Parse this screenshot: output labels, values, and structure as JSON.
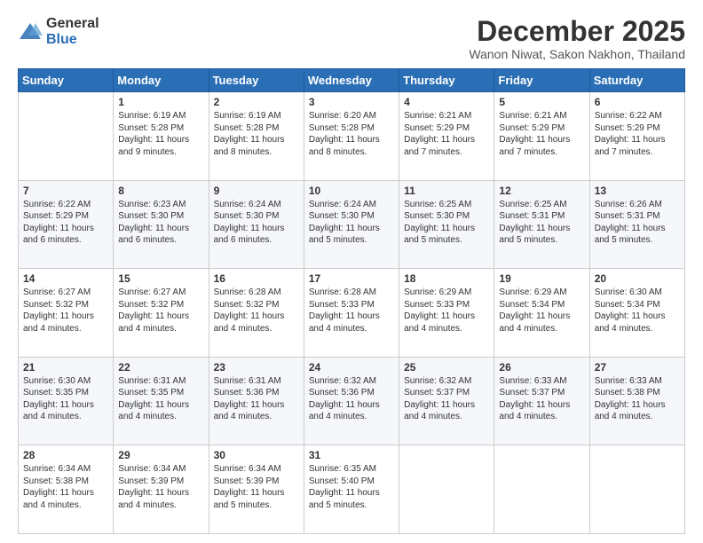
{
  "logo": {
    "general": "General",
    "blue": "Blue"
  },
  "header": {
    "title": "December 2025",
    "subtitle": "Wanon Niwat, Sakon Nakhon, Thailand"
  },
  "weekdays": [
    "Sunday",
    "Monday",
    "Tuesday",
    "Wednesday",
    "Thursday",
    "Friday",
    "Saturday"
  ],
  "weeks": [
    [
      {
        "day": "",
        "sunrise": "",
        "sunset": "",
        "daylight": ""
      },
      {
        "day": "1",
        "sunrise": "Sunrise: 6:19 AM",
        "sunset": "Sunset: 5:28 PM",
        "daylight": "Daylight: 11 hours and 9 minutes."
      },
      {
        "day": "2",
        "sunrise": "Sunrise: 6:19 AM",
        "sunset": "Sunset: 5:28 PM",
        "daylight": "Daylight: 11 hours and 8 minutes."
      },
      {
        "day": "3",
        "sunrise": "Sunrise: 6:20 AM",
        "sunset": "Sunset: 5:28 PM",
        "daylight": "Daylight: 11 hours and 8 minutes."
      },
      {
        "day": "4",
        "sunrise": "Sunrise: 6:21 AM",
        "sunset": "Sunset: 5:29 PM",
        "daylight": "Daylight: 11 hours and 7 minutes."
      },
      {
        "day": "5",
        "sunrise": "Sunrise: 6:21 AM",
        "sunset": "Sunset: 5:29 PM",
        "daylight": "Daylight: 11 hours and 7 minutes."
      },
      {
        "day": "6",
        "sunrise": "Sunrise: 6:22 AM",
        "sunset": "Sunset: 5:29 PM",
        "daylight": "Daylight: 11 hours and 7 minutes."
      }
    ],
    [
      {
        "day": "7",
        "sunrise": "Sunrise: 6:22 AM",
        "sunset": "Sunset: 5:29 PM",
        "daylight": "Daylight: 11 hours and 6 minutes."
      },
      {
        "day": "8",
        "sunrise": "Sunrise: 6:23 AM",
        "sunset": "Sunset: 5:30 PM",
        "daylight": "Daylight: 11 hours and 6 minutes."
      },
      {
        "day": "9",
        "sunrise": "Sunrise: 6:24 AM",
        "sunset": "Sunset: 5:30 PM",
        "daylight": "Daylight: 11 hours and 6 minutes."
      },
      {
        "day": "10",
        "sunrise": "Sunrise: 6:24 AM",
        "sunset": "Sunset: 5:30 PM",
        "daylight": "Daylight: 11 hours and 5 minutes."
      },
      {
        "day": "11",
        "sunrise": "Sunrise: 6:25 AM",
        "sunset": "Sunset: 5:30 PM",
        "daylight": "Daylight: 11 hours and 5 minutes."
      },
      {
        "day": "12",
        "sunrise": "Sunrise: 6:25 AM",
        "sunset": "Sunset: 5:31 PM",
        "daylight": "Daylight: 11 hours and 5 minutes."
      },
      {
        "day": "13",
        "sunrise": "Sunrise: 6:26 AM",
        "sunset": "Sunset: 5:31 PM",
        "daylight": "Daylight: 11 hours and 5 minutes."
      }
    ],
    [
      {
        "day": "14",
        "sunrise": "Sunrise: 6:27 AM",
        "sunset": "Sunset: 5:32 PM",
        "daylight": "Daylight: 11 hours and 4 minutes."
      },
      {
        "day": "15",
        "sunrise": "Sunrise: 6:27 AM",
        "sunset": "Sunset: 5:32 PM",
        "daylight": "Daylight: 11 hours and 4 minutes."
      },
      {
        "day": "16",
        "sunrise": "Sunrise: 6:28 AM",
        "sunset": "Sunset: 5:32 PM",
        "daylight": "Daylight: 11 hours and 4 minutes."
      },
      {
        "day": "17",
        "sunrise": "Sunrise: 6:28 AM",
        "sunset": "Sunset: 5:33 PM",
        "daylight": "Daylight: 11 hours and 4 minutes."
      },
      {
        "day": "18",
        "sunrise": "Sunrise: 6:29 AM",
        "sunset": "Sunset: 5:33 PM",
        "daylight": "Daylight: 11 hours and 4 minutes."
      },
      {
        "day": "19",
        "sunrise": "Sunrise: 6:29 AM",
        "sunset": "Sunset: 5:34 PM",
        "daylight": "Daylight: 11 hours and 4 minutes."
      },
      {
        "day": "20",
        "sunrise": "Sunrise: 6:30 AM",
        "sunset": "Sunset: 5:34 PM",
        "daylight": "Daylight: 11 hours and 4 minutes."
      }
    ],
    [
      {
        "day": "21",
        "sunrise": "Sunrise: 6:30 AM",
        "sunset": "Sunset: 5:35 PM",
        "daylight": "Daylight: 11 hours and 4 minutes."
      },
      {
        "day": "22",
        "sunrise": "Sunrise: 6:31 AM",
        "sunset": "Sunset: 5:35 PM",
        "daylight": "Daylight: 11 hours and 4 minutes."
      },
      {
        "day": "23",
        "sunrise": "Sunrise: 6:31 AM",
        "sunset": "Sunset: 5:36 PM",
        "daylight": "Daylight: 11 hours and 4 minutes."
      },
      {
        "day": "24",
        "sunrise": "Sunrise: 6:32 AM",
        "sunset": "Sunset: 5:36 PM",
        "daylight": "Daylight: 11 hours and 4 minutes."
      },
      {
        "day": "25",
        "sunrise": "Sunrise: 6:32 AM",
        "sunset": "Sunset: 5:37 PM",
        "daylight": "Daylight: 11 hours and 4 minutes."
      },
      {
        "day": "26",
        "sunrise": "Sunrise: 6:33 AM",
        "sunset": "Sunset: 5:37 PM",
        "daylight": "Daylight: 11 hours and 4 minutes."
      },
      {
        "day": "27",
        "sunrise": "Sunrise: 6:33 AM",
        "sunset": "Sunset: 5:38 PM",
        "daylight": "Daylight: 11 hours and 4 minutes."
      }
    ],
    [
      {
        "day": "28",
        "sunrise": "Sunrise: 6:34 AM",
        "sunset": "Sunset: 5:38 PM",
        "daylight": "Daylight: 11 hours and 4 minutes."
      },
      {
        "day": "29",
        "sunrise": "Sunrise: 6:34 AM",
        "sunset": "Sunset: 5:39 PM",
        "daylight": "Daylight: 11 hours and 4 minutes."
      },
      {
        "day": "30",
        "sunrise": "Sunrise: 6:34 AM",
        "sunset": "Sunset: 5:39 PM",
        "daylight": "Daylight: 11 hours and 5 minutes."
      },
      {
        "day": "31",
        "sunrise": "Sunrise: 6:35 AM",
        "sunset": "Sunset: 5:40 PM",
        "daylight": "Daylight: 11 hours and 5 minutes."
      },
      {
        "day": "",
        "sunrise": "",
        "sunset": "",
        "daylight": ""
      },
      {
        "day": "",
        "sunrise": "",
        "sunset": "",
        "daylight": ""
      },
      {
        "day": "",
        "sunrise": "",
        "sunset": "",
        "daylight": ""
      }
    ]
  ]
}
